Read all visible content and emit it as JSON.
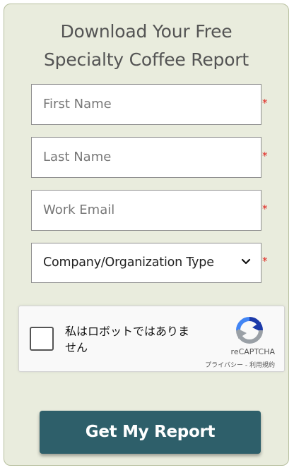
{
  "form": {
    "title_line1": "Download Your Free",
    "title_line2": "Specialty Coffee Report",
    "required_marker": "*",
    "fields": [
      {
        "placeholder": "First Name"
      },
      {
        "placeholder": "Last Name"
      },
      {
        "placeholder": "Work Email"
      }
    ],
    "company_type": {
      "selected": "Company/Organization Type"
    },
    "recaptcha": {
      "label": "私はロボットではありません",
      "brand": "reCAPTCHA",
      "privacy": "プライバシー",
      "separator": " - ",
      "terms": "利用規約"
    },
    "submit_label": "Get My Report"
  },
  "colors": {
    "card_background": "#e9ecdd",
    "title": "#545454",
    "required": "#e0241f",
    "button": "#2e5f6a",
    "button_text": "#ffffff"
  }
}
